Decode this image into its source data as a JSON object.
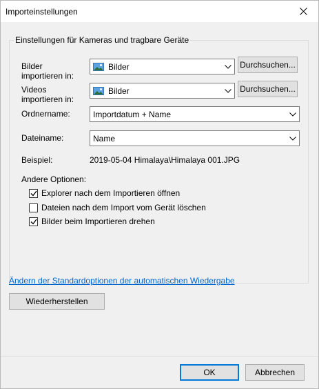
{
  "window": {
    "title": "Importeinstellungen",
    "close_glyph": "✕"
  },
  "group": {
    "title": "Einstellungen für Kameras und tragbare Geräte"
  },
  "rows": {
    "bilder_label_line1": "Bilder",
    "bilder_label_line2": "importieren in:",
    "bilder_value": "Bilder",
    "videos_label_line1": "Videos",
    "videos_label_line2": "importieren in:",
    "videos_value": "Bilder",
    "browse_label": "Durchsuchen...",
    "ordner_label": "Ordnername:",
    "ordner_value": "Importdatum + Name",
    "datei_label": "Dateiname:",
    "datei_value": "Name",
    "beispiel_label": "Beispiel:",
    "beispiel_value": "2019-05-04 Himalaya\\Himalaya 001.JPG"
  },
  "options": {
    "title": "Andere Optionen:",
    "items": [
      {
        "label": "Explorer nach dem Importieren öffnen",
        "checked": true
      },
      {
        "label": "Dateien nach dem Import vom Gerät löschen",
        "checked": false
      },
      {
        "label": "Bilder beim Importieren drehen",
        "checked": true
      }
    ]
  },
  "link_text": "Ändern der Standardoptionen der automatischen Wiedergabe",
  "restore_label": "Wiederherstellen",
  "footer": {
    "ok_label": "OK",
    "cancel_label": "Abbrechen"
  },
  "icons": {
    "folder": "picture-folder-icon",
    "chevron": "chevron-down-icon",
    "check": "check-icon"
  },
  "colors": {
    "accent": "#0078d7",
    "link": "#0066cc"
  }
}
